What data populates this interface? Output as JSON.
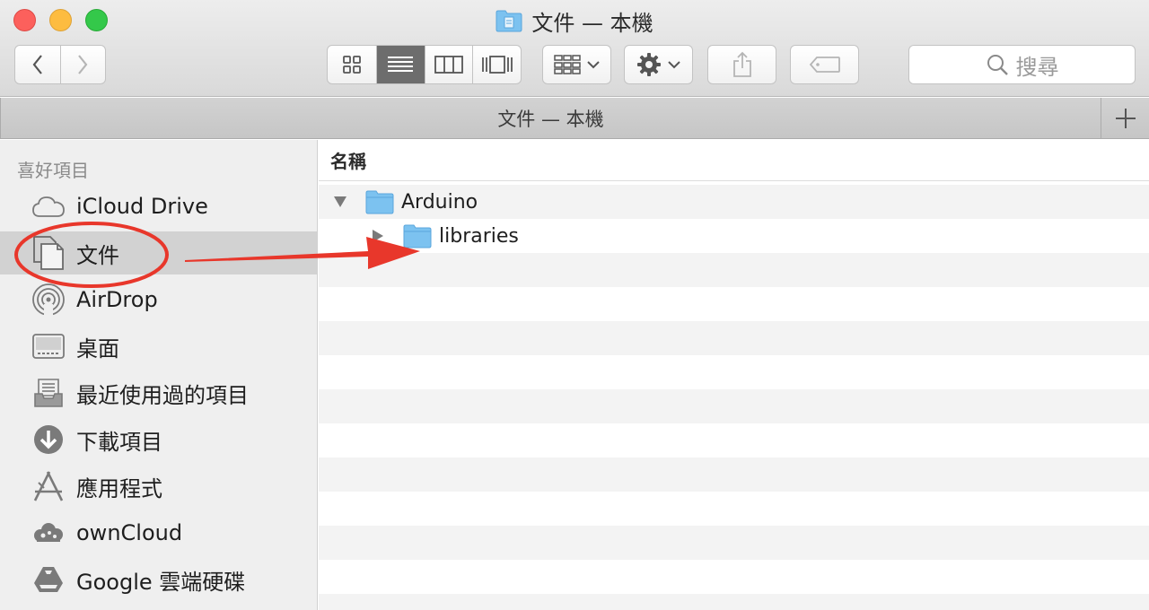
{
  "window": {
    "title": "文件 — 本機"
  },
  "toolbar": {
    "back_icon": "chevron-left-icon",
    "forward_icon": "chevron-right-icon",
    "view_modes": [
      "icon-view",
      "list-view",
      "column-view",
      "cover-flow-view"
    ],
    "active_view": "list-view",
    "arrange_icon": "arrange-grid-icon",
    "action_icon": "gear-icon",
    "share_icon": "share-icon",
    "tag_icon": "tag-icon",
    "search_placeholder": "搜尋"
  },
  "tabbar": {
    "tab_label": "文件 — 本機",
    "add_icon": "plus-icon"
  },
  "sidebar": {
    "heading": "喜好項目",
    "items": [
      {
        "label": "iCloud Drive",
        "icon": "cloud-icon"
      },
      {
        "label": "文件",
        "icon": "document-icon",
        "selected": true
      },
      {
        "label": "AirDrop",
        "icon": "airdrop-icon"
      },
      {
        "label": "桌面",
        "icon": "desktop-icon"
      },
      {
        "label": "最近使用過的項目",
        "icon": "recents-icon"
      },
      {
        "label": "下載項目",
        "icon": "download-icon"
      },
      {
        "label": "應用程式",
        "icon": "applications-icon"
      },
      {
        "label": "ownCloud",
        "icon": "owncloud-icon"
      },
      {
        "label": "Google 雲端硬碟",
        "icon": "google-drive-icon"
      }
    ]
  },
  "content": {
    "column_name": "名稱",
    "rows": [
      {
        "name": "Arduino",
        "expanded": true,
        "level": 0
      },
      {
        "name": "libraries",
        "expanded": false,
        "level": 1
      }
    ]
  },
  "colors": {
    "annotation_red": "#e8372b",
    "folder_blue": "#7cc2f0",
    "selected_row": "#d2d2d2",
    "active_view_bg": "#6d6d6d"
  }
}
